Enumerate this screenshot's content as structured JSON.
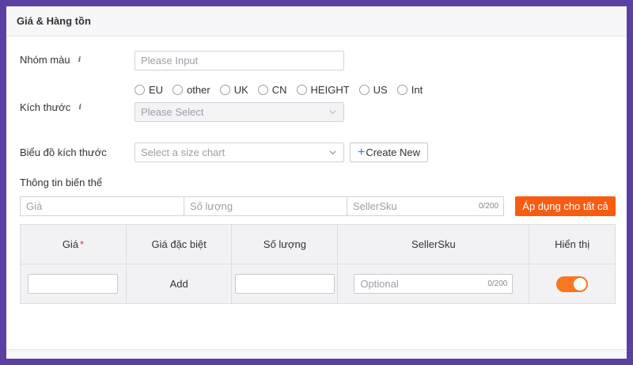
{
  "section": {
    "title": "Giá & Hàng tồn"
  },
  "color_group": {
    "label": "Nhóm màu",
    "placeholder": "Please Input"
  },
  "size": {
    "label": "Kích thước",
    "options": [
      "EU",
      "other",
      "UK",
      "CN",
      "HEIGHT",
      "US",
      "Int"
    ],
    "select_placeholder": "Please Select"
  },
  "size_chart": {
    "label": "Biểu đồ kích thước",
    "placeholder": "Select a size chart",
    "create_label": "Create New"
  },
  "variant_info": {
    "label": "Thông tin biến thể",
    "price_placeholder": "Giá",
    "quantity_placeholder": "Số lượng",
    "sku_placeholder": "SellerSku",
    "sku_counter": "0/200",
    "apply_label": "Áp dụng cho tất cả"
  },
  "table": {
    "headers": {
      "price": "Giá",
      "price_required_mark": "*",
      "special_price": "Giá đặc biệt",
      "quantity": "Số lượng",
      "seller_sku": "SellerSku",
      "visible": "Hiển thị"
    },
    "row": {
      "special_price_action": "Add",
      "sku_placeholder": "Optional",
      "sku_counter": "0/200",
      "visible_on": true
    }
  },
  "colors": {
    "accent": "#f75d12",
    "toggle": "#f7781f",
    "background": "#5b3fa3",
    "link_blue": "#2f7de1"
  }
}
